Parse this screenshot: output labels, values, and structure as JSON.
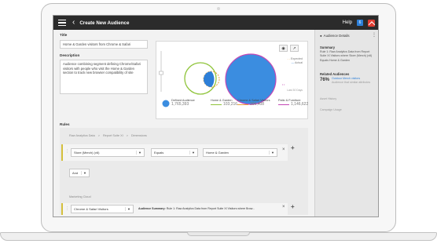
{
  "header": {
    "title": "Create New Audience",
    "help": "Help",
    "badge": "6"
  },
  "form": {
    "title_label": "Title",
    "title_value": "Home & Garden visitors from Chrome & Safari",
    "desc_label": "Description",
    "desc_value": "Audience combining segment defining Chrome/Safari visitors with people who visit the Home & Garden section to track new browser compatibility of site"
  },
  "viz": {
    "legend_expected": "Expected",
    "legend_actual": "Actual",
    "last_days": "Last 30 Days",
    "defined_label": "Defined Audience",
    "defined_value": "1,765,393",
    "stats": [
      {
        "label": "Home & Garden",
        "value": "103,216",
        "color": "#8fc43a"
      },
      {
        "label": "Chrome & Safari Visitors",
        "value": "306,408",
        "color": "#e8a23c"
      },
      {
        "label": "Patio & Furniture",
        "value": "1,146,622",
        "color": "#c447b5"
      }
    ]
  },
  "rules": {
    "label": "Rules",
    "breadcrumb": [
      "Raw Analytics Data",
      ">",
      "Report Suite XI",
      ">",
      "Dimensions"
    ],
    "row1": {
      "dimension": "Store (Merch) (v6)",
      "operator": "Equals",
      "value": "Home & Garden"
    },
    "connector": "And",
    "marketing_cloud": "Marketing Cloud",
    "row2": {
      "segment": "Chrome & Safari Visitors",
      "summary_label": "Audience Summary:",
      "summary_text": "Rule 1: Raw Analytics Data from Report Suite XI Visitors where Brow..."
    }
  },
  "details": {
    "head": "Audience Details",
    "summary_title": "Summary",
    "summary_text": "Rule 1: Raw Analytics Data from Report Suite XI Visitors where Store (Merch) (v6) Equals Home & Garden",
    "related_title": "Related Audiences",
    "related_percent": "76%",
    "related_name": "Outdoor Merch visitors",
    "related_sub": "Audience that similar attributes",
    "history": "Asset History",
    "campaign": "Campaign Usage"
  },
  "colors": {
    "accent": "#2d7fd8",
    "green": "#8fc43a",
    "orange": "#e8a23c",
    "magenta": "#c447b5",
    "topbar": "#2b2b2b"
  }
}
